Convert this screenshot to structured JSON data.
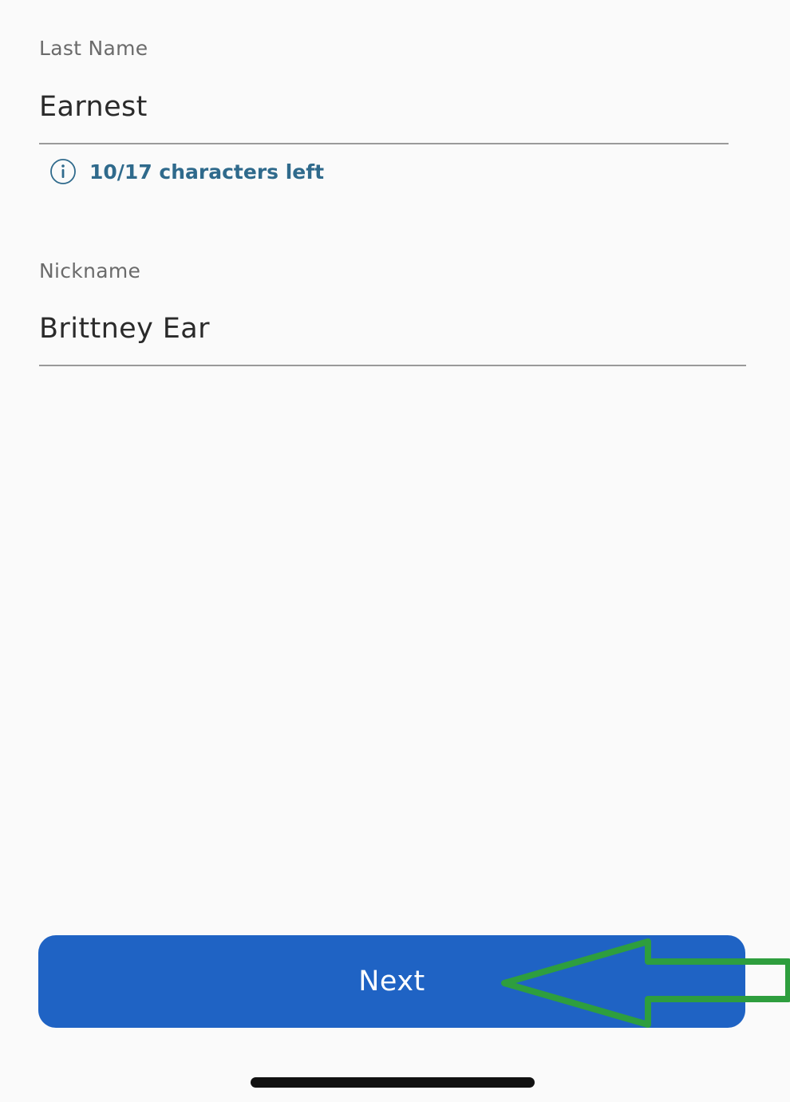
{
  "form": {
    "last_name": {
      "label": "Last Name",
      "value": "Earnest",
      "hint": "10/17 characters left"
    },
    "nickname": {
      "label": "Nickname",
      "value": "Brittney Ear"
    }
  },
  "actions": {
    "next_label": "Next"
  },
  "icons": {
    "hint_icon": "info-icon",
    "annotation": "arrow-left-icon"
  },
  "colors": {
    "primary_button": "#1f63c4",
    "hint_text": "#2f6a8c",
    "annotation_arrow": "#2e9e3e"
  }
}
